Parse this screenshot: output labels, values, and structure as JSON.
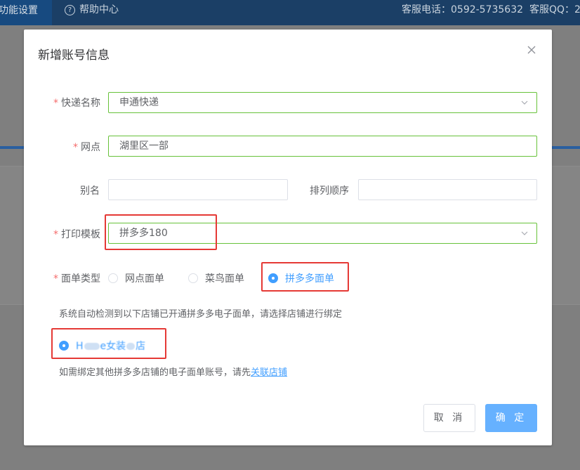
{
  "background": {
    "active_tab": "功能设置",
    "help_link": "帮助中心",
    "phone": "客服电话：0592-5735632",
    "qq": "客服QQ：2"
  },
  "dialog": {
    "title": "新增账号信息",
    "fields": {
      "courier": {
        "label": "快递名称",
        "value": "申通快递"
      },
      "outlet": {
        "label": "网点",
        "value": "湖里区一部"
      },
      "alias": {
        "label": "别名",
        "value": ""
      },
      "sort_order": {
        "label": "排列顺序",
        "value": ""
      },
      "template": {
        "label": "打印模板",
        "value": "拼多多180"
      },
      "waybill_type": {
        "label": "面单类型",
        "options": [
          "网点面单",
          "菜鸟面单",
          "拼多多面单"
        ],
        "selected": "拼多多面单"
      }
    },
    "detect_hint": "系统自动检测到以下店铺已开通拼多多电子面单，请选择店铺进行绑定",
    "shop": {
      "prefix": "H",
      "mid": "e女装",
      "suffix": "店"
    },
    "bind_hint": "如需绑定其他拼多多店铺的电子面单账号，请先",
    "bind_link": "关联店铺",
    "buttons": {
      "cancel": "取 消",
      "ok": "确 定"
    }
  },
  "colors": {
    "primary": "#409eff",
    "success_border": "#67c23a",
    "required": "#f56c6c",
    "highlight": "#e53935"
  }
}
